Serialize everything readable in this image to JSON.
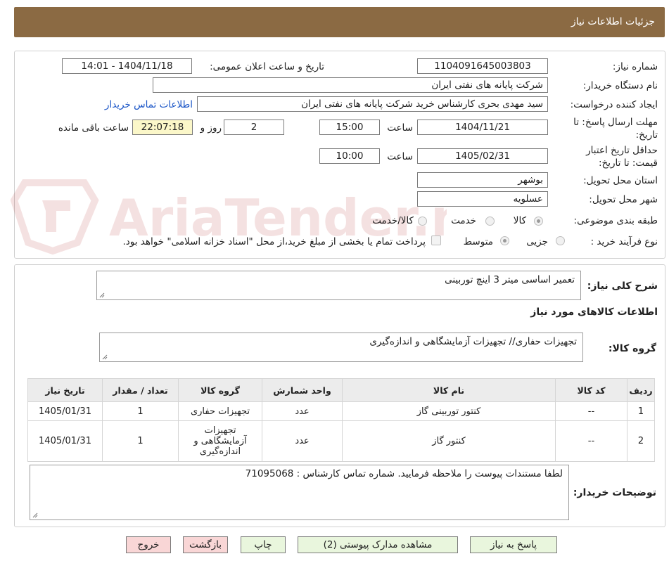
{
  "header": {
    "title": "جزئیات اطلاعات نیاز"
  },
  "form": {
    "need_number_label": "شماره نیاز:",
    "need_number": "1104091645003803",
    "announce_label": "تاریخ و ساعت اعلان عمومی:",
    "announce_value": "1404/11/18 - 14:01",
    "buyer_org_label": "نام دستگاه خریدار:",
    "buyer_org": "شرکت پایانه های نفتی ایران",
    "creator_label": "ایجاد کننده درخواست:",
    "creator": "سید مهدی  بحری کارشناس خرید شرکت پایانه های نفتی ایران",
    "contact_link": "اطلاعات تماس خریدار",
    "deadline_label_1": "مهلت ارسال پاسخ: تا",
    "deadline_label_2": "تاریخ:",
    "deadline_date": "1404/11/21",
    "time_label": "ساعت",
    "deadline_time": "15:00",
    "days_value": "2",
    "days_label": "روز و",
    "remaining_time": "22:07:18",
    "remaining_label": "ساعت باقی مانده",
    "validity_label_1": "حداقل تاریخ اعتبار",
    "validity_label_2": "قیمت: تا تاریخ:",
    "validity_date": "1405/02/31",
    "validity_time": "10:00",
    "province_label": "استان محل تحویل:",
    "province": "بوشهر",
    "city_label": "شهر محل تحویل:",
    "city": "عسلویه",
    "category_label": "طبقه بندی موضوعی:",
    "category_options": [
      "کالا",
      "خدمت",
      "کالا/خدمت"
    ],
    "process_label": "نوع فرآیند خرید :",
    "process_options": [
      "جزیی",
      "متوسط"
    ],
    "treasury_note": "پرداخت تمام یا بخشی از مبلغ خرید،از محل \"اسناد خزانه اسلامی\" خواهد بود."
  },
  "summary": {
    "desc_label": "شرح کلی نیاز:",
    "desc_value": "تعمیر اساسی میتر 3 اینچ توربینی",
    "goods_info_title": "اطلاعات کالاهای مورد نیاز",
    "goods_group_label": "گروه کالا:",
    "goods_group_value": "تجهیزات حفاری// تجهیزات آزمایشگاهی و اندازه‌گیری"
  },
  "table": {
    "headers": [
      "ردیف",
      "کد کالا",
      "نام کالا",
      "واحد شمارش",
      "گروه کالا",
      "تعداد / مقدار",
      "تاریخ نیاز"
    ],
    "rows": [
      [
        "1",
        "--",
        "کنتور توربینی گاز",
        "عدد",
        "تجهیزات حفاری",
        "1",
        "1405/01/31"
      ],
      [
        "2",
        "--",
        "کنتور گاز",
        "عدد",
        "تجهیزات آزمایشگاهی و اندازه‌گیری",
        "1",
        "1405/01/31"
      ]
    ]
  },
  "notes": {
    "label": "توضیحات خریدار:",
    "value": "لطفا مستندات پیوست را ملاحظه فرمایید. شماره تماس کارشناس : 71095068"
  },
  "buttons": {
    "reply": "پاسخ به نیاز",
    "attachments": "مشاهده مدارک پیوستی (2)",
    "print": "چاپ",
    "back": "بازگشت",
    "exit": "خروج"
  },
  "watermark": {
    "text": "AriaTender.neT"
  },
  "colors": {
    "header": "#8b6a43",
    "button_green": "#e9f6dd",
    "button_red": "#f9d6d6",
    "highlight": "#fbf7c9",
    "link": "#1a55c7"
  }
}
